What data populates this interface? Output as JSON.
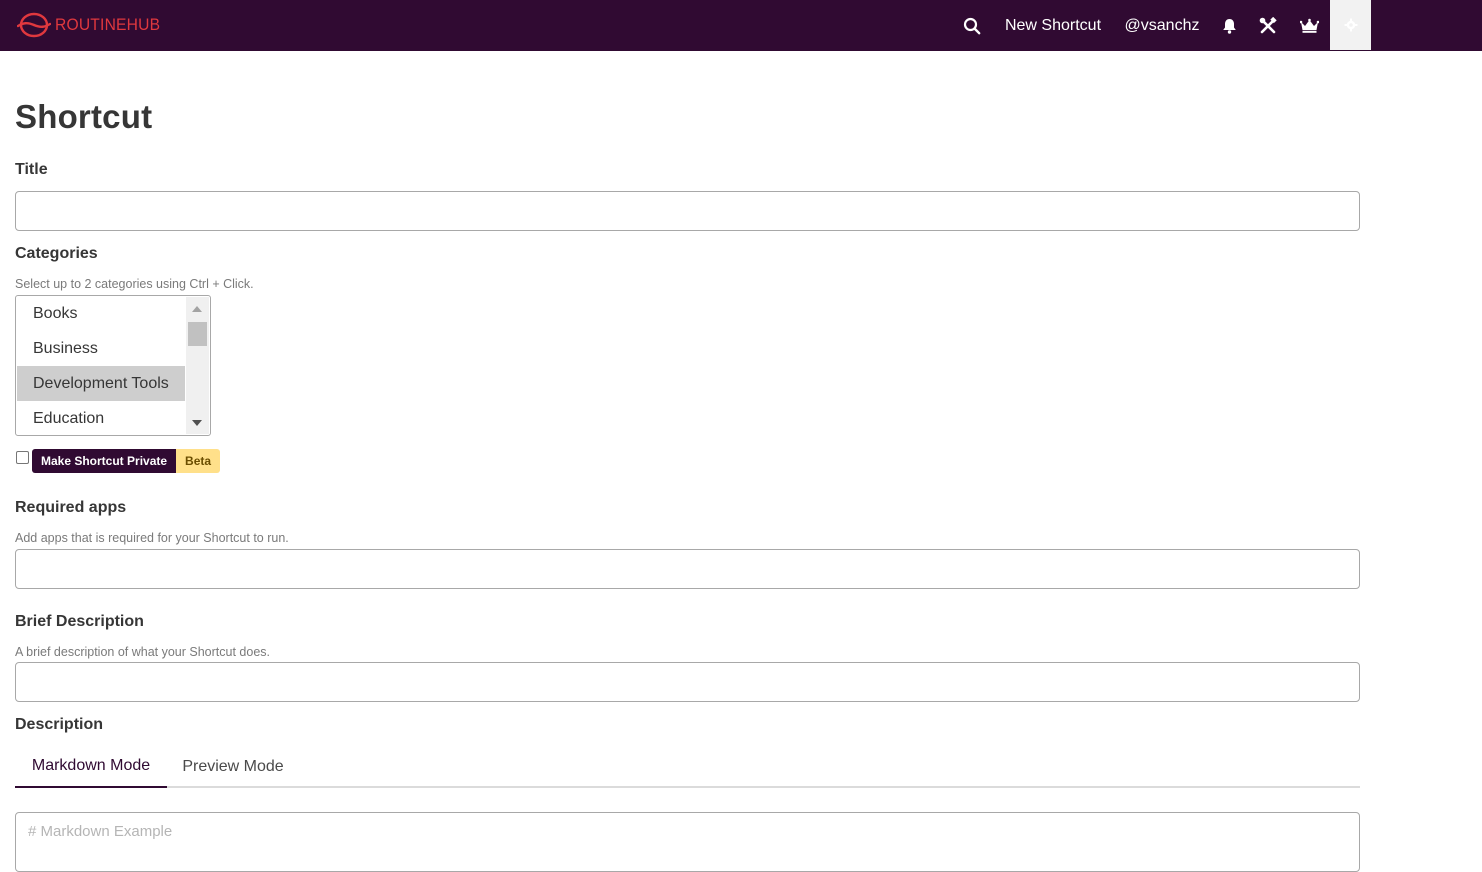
{
  "navbar": {
    "brand": "ROUTINEHUB",
    "new_shortcut": "New Shortcut",
    "username": "@vsanchz",
    "icons": {
      "search": "search-icon",
      "bell": "bell-icon",
      "tools": "tools-icon",
      "crown": "crown-icon",
      "settings": "gear-icon"
    },
    "colors": {
      "background": "#300a32",
      "brand": "#e0383e"
    }
  },
  "page": {
    "title": "Shortcut"
  },
  "form": {
    "title": {
      "label": "Title",
      "value": ""
    },
    "categories": {
      "label": "Categories",
      "help": "Select up to 2 categories using Ctrl + Click.",
      "options": [
        {
          "label": "Books",
          "selected": false
        },
        {
          "label": "Business",
          "selected": false
        },
        {
          "label": "Development Tools",
          "selected": true
        },
        {
          "label": "Education",
          "selected": false
        }
      ]
    },
    "private": {
      "checked": false,
      "tag_label": "Make Shortcut Private",
      "beta_label": "Beta"
    },
    "required_apps": {
      "label": "Required apps",
      "help": "Add apps that is required for your Shortcut to run.",
      "value": ""
    },
    "brief_description": {
      "label": "Brief Description",
      "help": "A brief description of what your Shortcut does.",
      "value": ""
    },
    "description": {
      "label": "Description",
      "tabs": [
        {
          "label": "Markdown Mode",
          "active": true
        },
        {
          "label": "Preview Mode",
          "active": false
        }
      ],
      "placeholder": "# Markdown Example"
    }
  }
}
